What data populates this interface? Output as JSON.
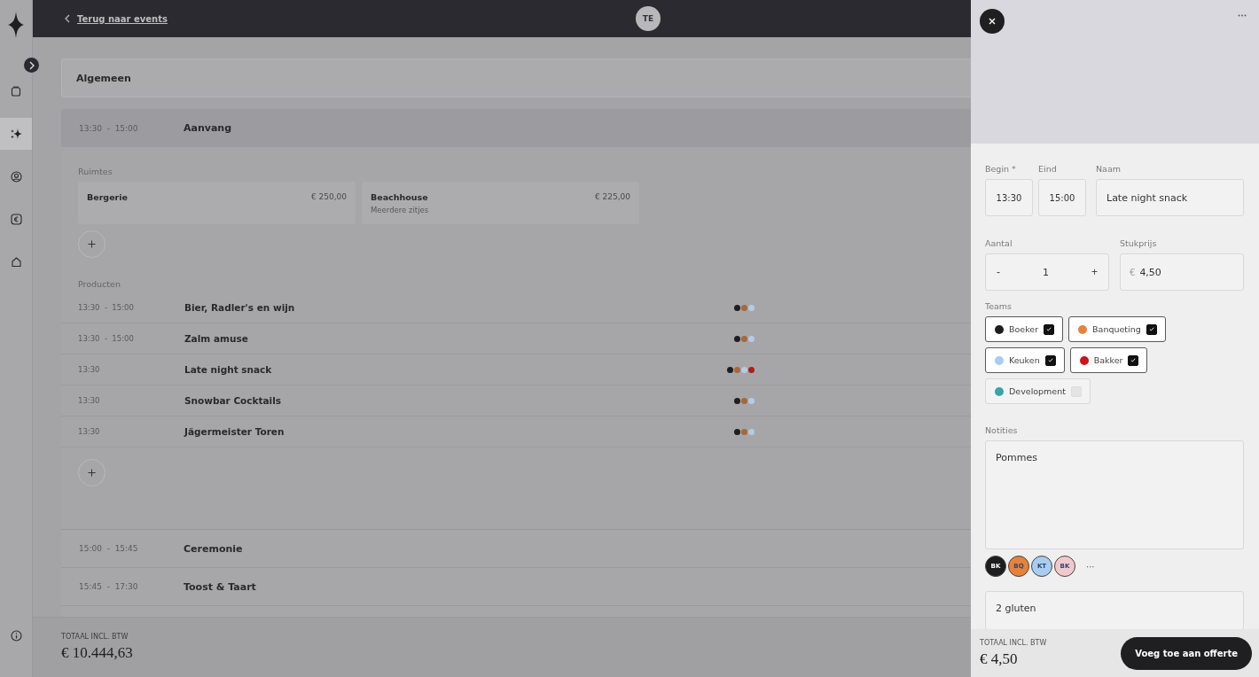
{
  "sidebar": {
    "items": [
      {
        "kind": "box",
        "selected": false
      },
      {
        "kind": "sparkle",
        "selected": true
      },
      {
        "kind": "user",
        "selected": false
      },
      {
        "kind": "euro",
        "selected": false
      },
      {
        "kind": "home",
        "selected": false
      }
    ]
  },
  "header": {
    "back_link": "Terug naar events",
    "avatar": "TE"
  },
  "general": {
    "title": "Algemeen"
  },
  "sections": [
    {
      "time": "13:30  -  15:00",
      "title": "Aanvang",
      "expanded": true,
      "rooms_label": "Ruimtes",
      "rooms": [
        {
          "name": "Bergerie",
          "price": "€ 250,00"
        },
        {
          "name": "Beachhouse",
          "price": "€ 225,00",
          "subtitle": "Meerdere zitjes"
        }
      ],
      "products_label": "Producten",
      "products": [
        {
          "time": "13:30  -  15:00",
          "name": "Bier, Radler's en wijn",
          "teams": [
            {
              "color": "#1e1e20"
            },
            {
              "color": "#a4683a"
            },
            {
              "color": "#b4cbe6"
            }
          ]
        },
        {
          "time": "13:30  -  15:00",
          "name": "Zalm amuse",
          "teams": [
            {
              "color": "#1e1e20"
            },
            {
              "color": "#a4683a"
            },
            {
              "color": "#b4cbe6"
            }
          ]
        },
        {
          "time": "13:30",
          "name": "Late night snack",
          "teams": [
            {
              "color": "#1e1e20"
            },
            {
              "color": "#a4683a"
            },
            {
              "color": "#b4cbe6"
            },
            {
              "color": "#b01c20"
            }
          ]
        },
        {
          "time": "13:30",
          "name": "Snowbar Cocktails",
          "teams": [
            {
              "color": "#1e1e20"
            },
            {
              "color": "#a4683a"
            },
            {
              "color": "#b4cbe6"
            }
          ]
        },
        {
          "time": "13:30",
          "name": "Jägermeister Toren",
          "teams": [
            {
              "color": "#1e1e20"
            },
            {
              "color": "#a4683a"
            },
            {
              "color": "#b4cbe6"
            }
          ]
        }
      ]
    },
    {
      "time": "15:00  -  15:45",
      "title": "Ceremonie",
      "expanded": false
    },
    {
      "time": "15:45  -  17:30",
      "title": "Toost & Taart",
      "expanded": false
    }
  ],
  "footer": {
    "label": "TOTAAL INCL. BTW",
    "total": "€ 10.444,63"
  },
  "panel": {
    "begin": {
      "label": "Begin *",
      "value": "13:30"
    },
    "end": {
      "label": "Eind",
      "value": "15:00"
    },
    "name": {
      "label": "Naam",
      "value": "Late night snack"
    },
    "quantity": {
      "label": "Aantal",
      "minus": "-",
      "value": "1",
      "plus": "+"
    },
    "unit_price": {
      "label": "Stukprijs",
      "currency": "€",
      "value": "4,50"
    },
    "teams_label": "Teams",
    "teams": [
      {
        "name": "Boeker",
        "color": "#1d1d1f",
        "checked": true
      },
      {
        "name": "Banqueting",
        "color": "#e8823a",
        "checked": true
      },
      {
        "name": "Keuken",
        "color": "#a9cdf0",
        "checked": true
      },
      {
        "name": "Bakker",
        "color": "#c8141e",
        "checked": true
      },
      {
        "name": "Development",
        "color": "#3aa4a8",
        "checked": false
      }
    ],
    "notes_label": "Notities",
    "notes": [
      "Pommes",
      "2 gluten"
    ],
    "avatars": [
      {
        "initials": "BK",
        "color": "#1d1d1f"
      },
      {
        "initials": "BQ",
        "color": "#e8823a"
      },
      {
        "initials": "KT",
        "color": "#a9cdf0"
      },
      {
        "initials": "BK",
        "color": "#f1c9cd"
      }
    ],
    "more": "···",
    "footer_label": "TOTAAL INCL. BTW",
    "total": "€ 4,50",
    "submit": "Voeg toe aan offerte"
  }
}
